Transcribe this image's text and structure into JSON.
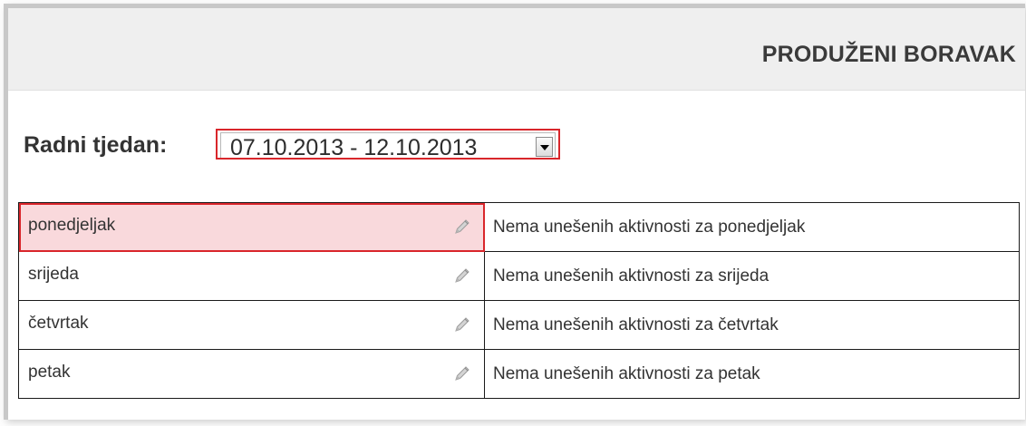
{
  "header": {
    "title": "PRODUŽENI BORAVAK"
  },
  "week": {
    "label": "Radni tjedan:",
    "selected": "07.10.2013 - 12.10.2013",
    "dropdown_icon": "chevron-down-icon"
  },
  "days": [
    {
      "day": "ponedjeljak",
      "note": "Nema unešenih aktivnosti za ponedjeljak",
      "selected": true,
      "icon": "pencil-icon"
    },
    {
      "day": "srijeda",
      "note": "Nema unešenih aktivnosti za srijeda",
      "selected": false,
      "icon": "pencil-icon"
    },
    {
      "day": "četvrtak",
      "note": "Nema unešenih aktivnosti za četvrtak",
      "selected": false,
      "icon": "pencil-icon"
    },
    {
      "day": "petak",
      "note": "Nema unešenih aktivnosti za petak",
      "selected": false,
      "icon": "pencil-icon"
    }
  ],
  "colors": {
    "highlight_border": "#d9262b",
    "highlight_fill": "#f9d9dc",
    "header_bg": "#efefef"
  }
}
